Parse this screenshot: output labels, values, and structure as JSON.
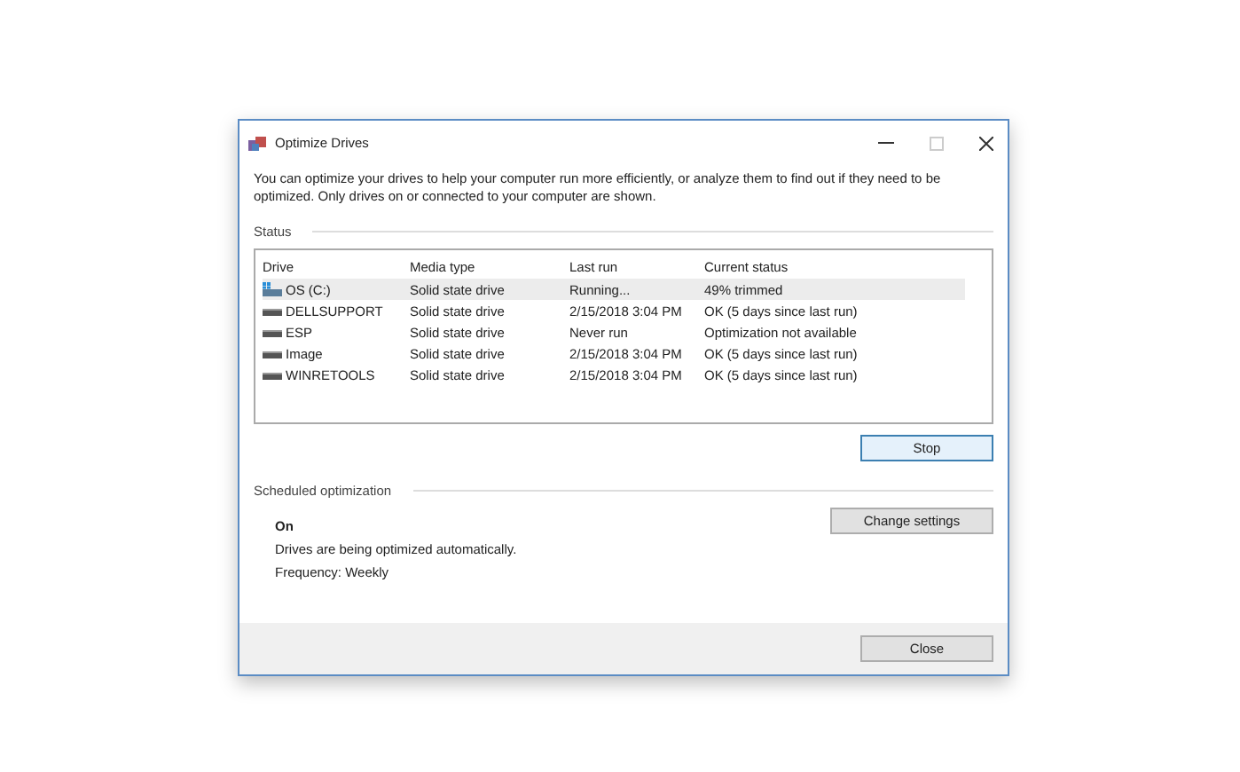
{
  "window": {
    "title": "Optimize Drives"
  },
  "description": "You can optimize your drives to help your computer run more efficiently, or analyze them to find out if they need to be optimized. Only drives on or connected to your computer are shown.",
  "status": {
    "heading": "Status",
    "table": {
      "columns": [
        "Drive",
        "Media type",
        "Last run",
        "Current status"
      ],
      "rows": [
        {
          "kind": "system",
          "selected": true,
          "cells": [
            "OS (C:)",
            "Solid state drive",
            "Running...",
            "49% trimmed"
          ]
        },
        {
          "kind": "drive",
          "selected": false,
          "cells": [
            "DELLSUPPORT",
            "Solid state drive",
            "2/15/2018 3:04 PM",
            "OK (5 days since last run)"
          ]
        },
        {
          "kind": "drive",
          "selected": false,
          "cells": [
            "ESP",
            "Solid state drive",
            "Never run",
            "Optimization not available"
          ]
        },
        {
          "kind": "drive",
          "selected": false,
          "cells": [
            "Image",
            "Solid state drive",
            "2/15/2018 3:04 PM",
            "OK (5 days since last run)"
          ]
        },
        {
          "kind": "drive",
          "selected": false,
          "cells": [
            "WINRETOOLS",
            "Solid state drive",
            "2/15/2018 3:04 PM",
            "OK (5 days since last run)"
          ]
        }
      ]
    },
    "button": "Stop"
  },
  "scheduled": {
    "heading": "Scheduled optimization",
    "state": "On",
    "description": "Drives are being optimized automatically.",
    "frequency": "Frequency: Weekly",
    "button": "Change settings"
  },
  "footer": {
    "button": "Close"
  }
}
